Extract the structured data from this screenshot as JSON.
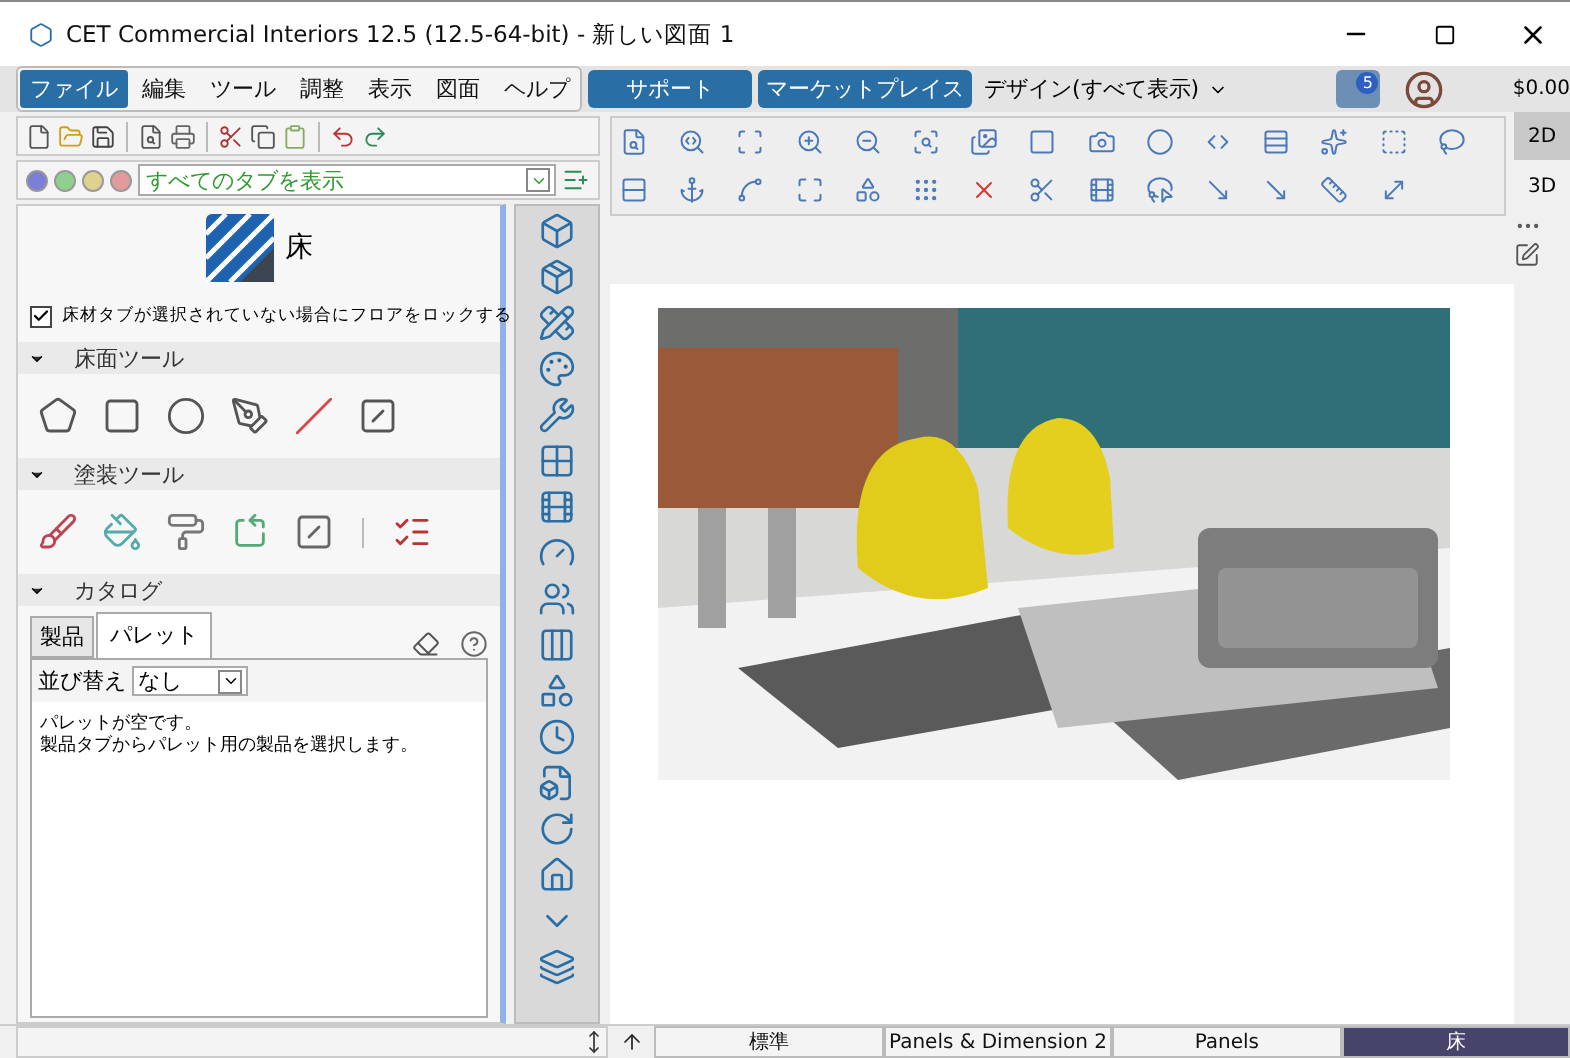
{
  "window": {
    "title": "CET Commercial Interiors 12.5 (12.5-64-bit) - 新しい図面 1"
  },
  "menu": [
    {
      "label": "ファイル",
      "selected": true
    },
    {
      "label": "編集",
      "selected": false
    },
    {
      "label": "ツール",
      "selected": false
    },
    {
      "label": "調整",
      "selected": false
    },
    {
      "label": "表示",
      "selected": false
    },
    {
      "label": "図面",
      "selected": false
    },
    {
      "label": "ヘルプ",
      "selected": false
    }
  ],
  "top_buttons": [
    "サポート",
    "マーケットプレイス"
  ],
  "design_dropdown": "デザイン(すべて表示)",
  "notification_count": "5",
  "balance": "$0.00",
  "tab_filter": "すべてのタブを表示",
  "panel": {
    "title": "床",
    "lock_option": {
      "label": "床材タブが選択されていない場合にフロアをロックする",
      "checked": true
    },
    "sections": [
      {
        "title": "床面ツール",
        "expanded": true
      },
      {
        "title": "塗装ツール",
        "expanded": true
      },
      {
        "title": "カタログ",
        "expanded": true
      }
    ],
    "catalog_tabs": [
      {
        "label": "製品",
        "selected": false
      },
      {
        "label": "パレット",
        "selected": true
      }
    ],
    "sort_label": "並び替え",
    "sort_value": "なし",
    "message": [
      "パレットが空です。",
      "製品タブからパレット用の製品を選択します。"
    ]
  },
  "view_modes": [
    {
      "label": "2D",
      "selected": true
    },
    {
      "label": "3D",
      "selected": false
    }
  ],
  "canvas": {
    "kind": "picture"
  },
  "bottom_tabs": [
    {
      "label": "標準",
      "selected": false
    },
    {
      "label": "Panels & Dimension 2",
      "selected": false
    },
    {
      "label": "Panels",
      "selected": false
    },
    {
      "label": "床",
      "selected": true
    }
  ]
}
